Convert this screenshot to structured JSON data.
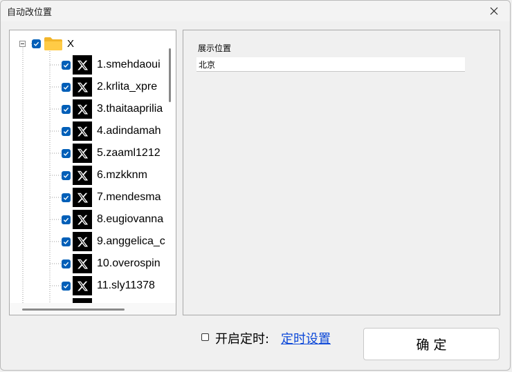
{
  "window": {
    "title": "自动改位置"
  },
  "tree": {
    "root": {
      "label": "X",
      "checked": true,
      "icon": "folder-icon"
    },
    "items": [
      {
        "label": "1.smehdaoui",
        "checked": true,
        "icon": "x-logo-icon"
      },
      {
        "label": "2.krlita_xpre",
        "checked": true,
        "icon": "x-logo-icon"
      },
      {
        "label": "3.thaitaaprilia",
        "checked": true,
        "icon": "x-logo-icon"
      },
      {
        "label": "4.adindamah",
        "checked": true,
        "icon": "x-logo-icon"
      },
      {
        "label": "5.zaaml1212",
        "checked": true,
        "icon": "x-logo-icon"
      },
      {
        "label": "6.mzkknm",
        "checked": true,
        "icon": "x-logo-icon"
      },
      {
        "label": "7.mendesma",
        "checked": true,
        "icon": "x-logo-icon"
      },
      {
        "label": "8.eugiovanna",
        "checked": true,
        "icon": "x-logo-icon"
      },
      {
        "label": "9.anggelica_c",
        "checked": true,
        "icon": "x-logo-icon"
      },
      {
        "label": "10.overospin",
        "checked": true,
        "icon": "x-logo-icon"
      },
      {
        "label": "11.sly11378",
        "checked": true,
        "icon": "x-logo-icon"
      }
    ]
  },
  "settings": {
    "display_location_label": "展示位置",
    "display_location_value": "北京"
  },
  "footer": {
    "timer_label": "开启定时:",
    "timer_checked": false,
    "timer_settings_link": "定时设置",
    "confirm_label": "确 定"
  },
  "colors": {
    "checkbox": "#005fb8",
    "link": "#0b47d8"
  }
}
